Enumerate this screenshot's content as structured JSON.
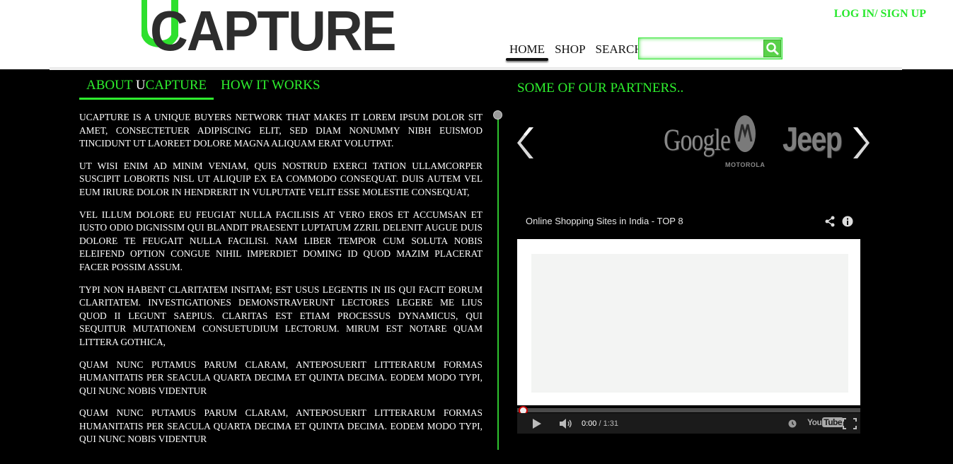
{
  "header": {
    "logo_letter": "U",
    "logo_text": "CAPTURE",
    "login_label": "LOG IN",
    "login_sep": "/",
    "signup_label": " SIGN UP",
    "nav": [
      "HOME",
      "SHOP",
      "SEARCH"
    ],
    "search": {
      "value": "",
      "placeholder": ""
    }
  },
  "tabs": {
    "about_prefix": "ABOUT ",
    "about_u": "U",
    "about_rest": "CAPTURE",
    "how": "HOW IT WORKS"
  },
  "about": {
    "paragraphs": [
      "UCAPTURE IS A UNIQUE BUYERS NETWORK THAT MAKES IT LOREM IPSUM DOLOR SIT AMET, CONSECTETUER ADIPISCING ELIT, SED DIAM NONUMMY NIBH EUISMOD TINCIDUNT UT LAOREET DOLORE MAGNA ALIQUAM ERAT VOLUTPAT.",
      "UT WISI ENIM AD MINIM VENIAM, QUIS NOSTRUD EXERCI TATION ULLAMCORPER SUSCIPIT LOBORTIS NISL UT ALIQUIP EX EA COMMODO CONSEQUAT. DUIS AUTEM VEL EUM IRIURE DOLOR IN HENDRERIT IN VULPUTATE VELIT ESSE MOLESTIE CONSEQUAT,",
      "VEL ILLUM DOLORE EU FEUGIAT NULLA FACILISIS AT VERO EROS ET ACCUMSAN ET IUSTO ODIO DIGNISSIM QUI BLANDIT PRAESENT LUPTATUM ZZRIL DELENIT AUGUE DUIS DOLORE TE FEUGAIT NULLA FACILISI. NAM LIBER TEMPOR CUM SOLUTA NOBIS ELEIFEND OPTION CONGUE NIHIL IMPERDIET DOMING ID QUOD MAZIM PLACERAT FACER POSSIM ASSUM.",
      "TYPI NON HABENT CLARITATEM INSITAM; EST USUS LEGENTIS IN IIS QUI FACIT EORUM CLARITATEM. INVESTIGATIONES DEMONSTRAVERUNT LECTORES LEGERE ME LIUS QUOD II LEGUNT SAEPIUS. CLARITAS EST ETIAM PROCESSUS DYNAMICUS, QUI SEQUITUR MUTATIONEM CONSUETUDIUM LECTORUM. MIRUM EST NOTARE QUAM LITTERA GOTHICA,",
      "QUAM NUNC PUTAMUS PARUM CLARAM, ANTEPOSUERIT LITTERARUM FORMAS HUMANITATIS PER SEACULA QUARTA DECIMA ET QUINTA DECIMA. EODEM MODO TYPI, QUI NUNC NOBIS VIDENTUR",
      "QUAM NUNC PUTAMUS PARUM CLARAM, ANTEPOSUERIT LITTERARUM FORMAS HUMANITATIS PER SEACULA QUARTA DECIMA ET QUINTA DECIMA. EODEM MODO TYPI, QUI NUNC NOBIS VIDENTUR"
    ]
  },
  "partners": {
    "title": "SOME OF OUR PARTNERS..",
    "logos": {
      "google": "Google",
      "motorola": "MOTOROLA",
      "jeep": "Jeep"
    }
  },
  "video": {
    "title": "Online Shopping Sites in India - TOP 8",
    "current_time": "0:00",
    "separator": " / ",
    "duration": "1:31",
    "progress": 0,
    "yt_you": "You",
    "yt_tube": "Tube"
  },
  "colors": {
    "accent": "#2ef02e",
    "background": "#000000",
    "header_bg": "#ffffff"
  }
}
